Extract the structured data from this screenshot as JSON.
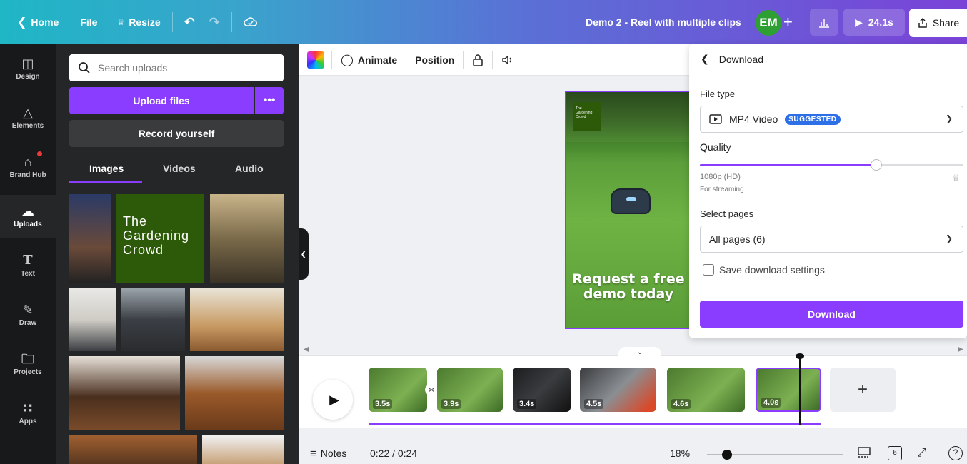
{
  "topbar": {
    "home_label": "Home",
    "file_label": "File",
    "resize_label": "Resize",
    "title": "Demo 2 - Reel with multiple clips",
    "avatar_initials": "EM",
    "play_duration": "24.1s",
    "share_label": "Share"
  },
  "rail": {
    "items": [
      {
        "label": "Design",
        "icon": "layout-icon"
      },
      {
        "label": "Elements",
        "icon": "shapes-icon"
      },
      {
        "label": "Brand Hub",
        "icon": "brand-icon"
      },
      {
        "label": "Uploads",
        "icon": "cloud-upload-icon"
      },
      {
        "label": "Text",
        "icon": "text-icon"
      },
      {
        "label": "Draw",
        "icon": "draw-icon"
      },
      {
        "label": "Projects",
        "icon": "folder-icon"
      },
      {
        "label": "Apps",
        "icon": "apps-grid-icon"
      }
    ]
  },
  "panel": {
    "search_placeholder": "Search uploads",
    "upload_label": "Upload files",
    "more_label": "•••",
    "record_label": "Record yourself",
    "tabs": [
      "Images",
      "Videos",
      "Audio"
    ],
    "gardening_tile": [
      "The",
      "Gardening",
      "Crowd"
    ]
  },
  "toolbar": {
    "animate_label": "Animate",
    "position_label": "Position"
  },
  "canvas": {
    "logo_text": "The Gardening Crowd",
    "promo_line1": "Request a free",
    "promo_line2": "demo today"
  },
  "download": {
    "title": "Download",
    "file_type_label": "File type",
    "file_type_value": "MP4 Video",
    "suggested_badge": "SUGGESTED",
    "quality_label": "Quality",
    "quality_value": "1080p (HD)",
    "quality_hint": "For streaming",
    "quality_fraction": 0.67,
    "pages_label": "Select pages",
    "pages_value": "All pages (6)",
    "save_settings_label": "Save download settings",
    "download_button": "Download"
  },
  "timeline": {
    "clips": [
      {
        "duration": "3.5s"
      },
      {
        "duration": "3.9s"
      },
      {
        "duration": "3.4s"
      },
      {
        "duration": "4.5s"
      },
      {
        "duration": "4.6s"
      },
      {
        "duration": "4.0s"
      }
    ],
    "add_label": "+"
  },
  "bottombar": {
    "notes_label": "Notes",
    "time": "0:22 / 0:24",
    "zoom": "18%",
    "page_count": "6"
  },
  "colors": {
    "accent": "#8b3dff",
    "panel_bg": "#252627",
    "rail_bg": "#18191b",
    "badge": "#2d6fe6"
  }
}
